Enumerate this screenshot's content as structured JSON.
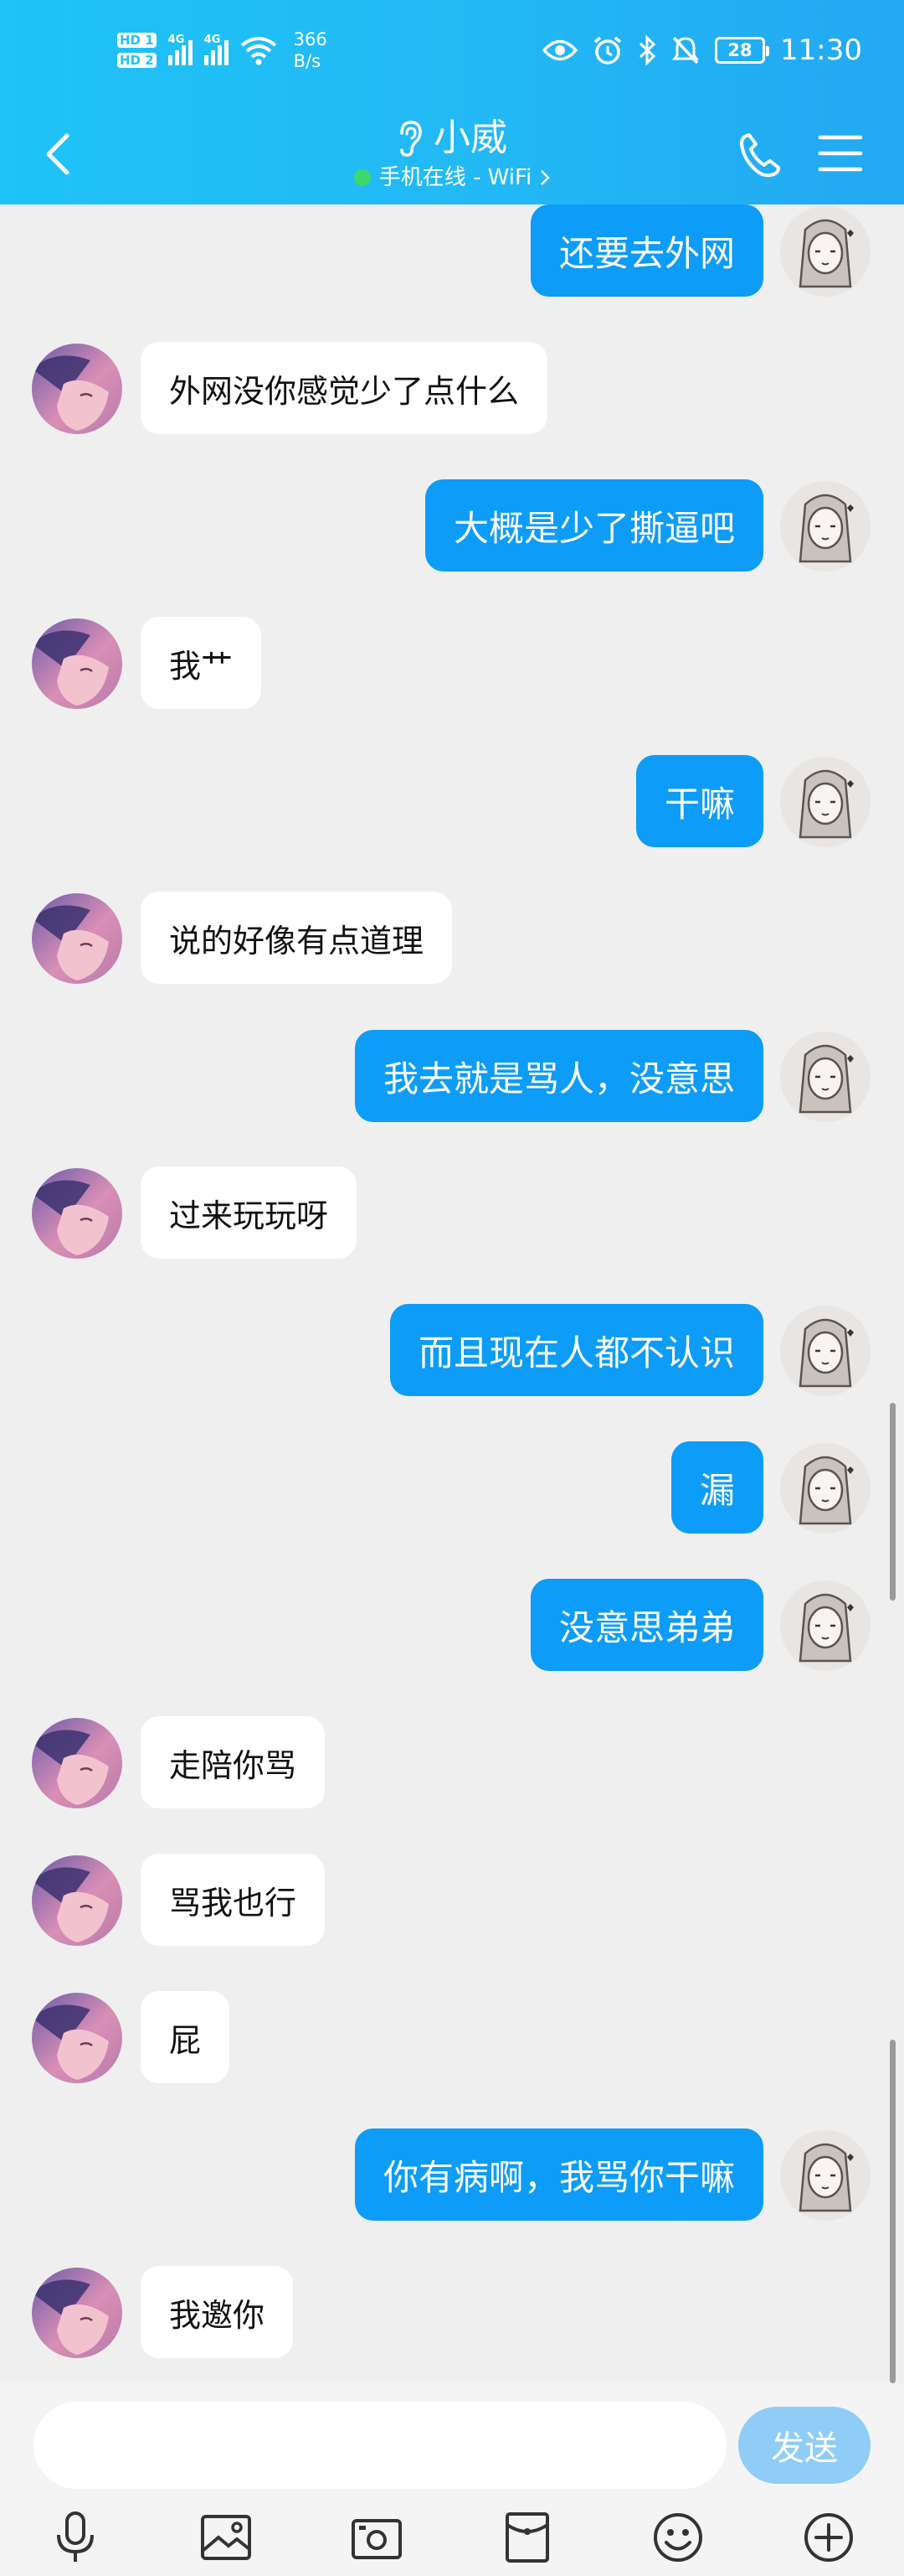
{
  "status_bar": {
    "sim1": "HD 1",
    "sim2": "HD 2",
    "network1": "4G",
    "network2": "4G",
    "speed_value": "366",
    "speed_unit": "B/s",
    "battery": "28",
    "time": "11:30"
  },
  "header": {
    "contact_name": "小威",
    "online_status": "手机在线 - WiFi",
    "colors": {
      "accent": "#1fc3f7",
      "online_dot": "#3ed96b"
    }
  },
  "messages": [
    {
      "side": "out",
      "text": "还要去外网"
    },
    {
      "side": "in",
      "text": "外网没你感觉少了点什么"
    },
    {
      "side": "out",
      "text": "大概是少了撕逼吧"
    },
    {
      "side": "in",
      "text": "我艹"
    },
    {
      "side": "out",
      "text": "干嘛"
    },
    {
      "side": "in",
      "text": "说的好像有点道理"
    },
    {
      "side": "out",
      "text": "我去就是骂人，没意思"
    },
    {
      "side": "in",
      "text": "过来玩玩呀"
    },
    {
      "side": "out",
      "text": "而且现在人都不认识"
    },
    {
      "side": "out",
      "text": "漏"
    },
    {
      "side": "out",
      "text": "没意思弟弟"
    },
    {
      "side": "in",
      "text": "走陪你骂"
    },
    {
      "side": "in",
      "text": "骂我也行"
    },
    {
      "side": "in",
      "text": "屁"
    },
    {
      "side": "out",
      "text": "你有病啊，我骂你干嘛"
    },
    {
      "side": "in",
      "text": "我邀你"
    }
  ],
  "input": {
    "value": "",
    "placeholder": ""
  },
  "send_label": "发送",
  "toolbar_icons": [
    "microphone-icon",
    "image-icon",
    "camera-icon",
    "red-packet-icon",
    "emoji-icon",
    "plus-icon"
  ],
  "bubble_colors": {
    "outgoing": "#0d9cf7",
    "incoming": "#ffffff"
  }
}
